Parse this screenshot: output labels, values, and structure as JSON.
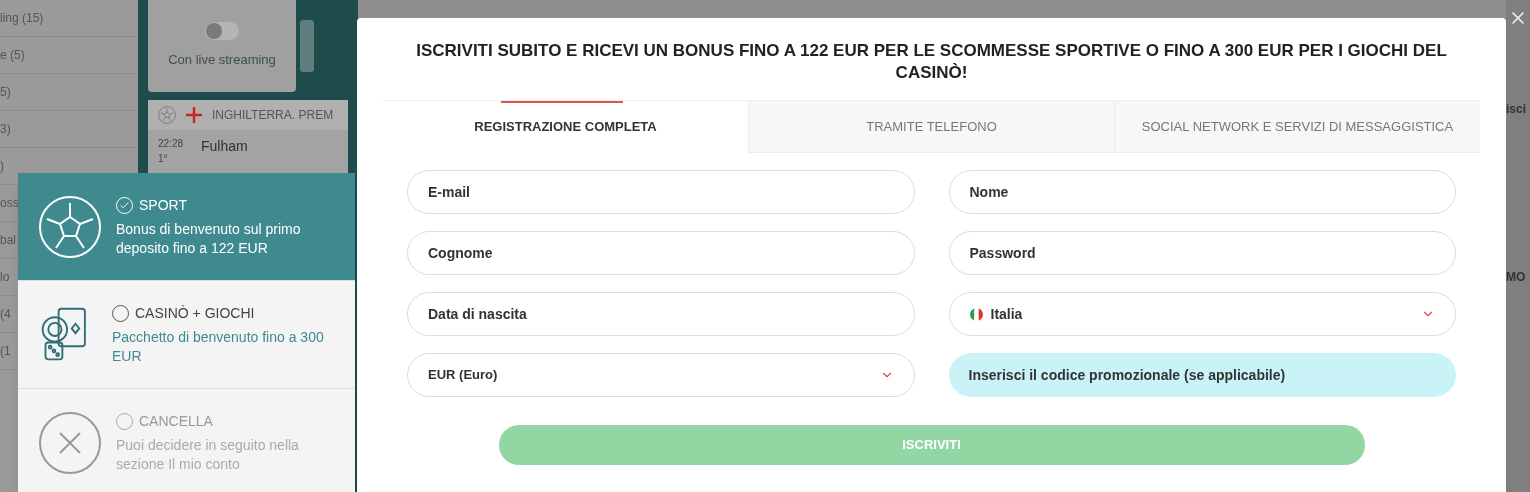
{
  "background": {
    "sidebar_items": [
      "ling (15)",
      "e (5)",
      "5)",
      "3)",
      ")",
      "oss",
      "bal",
      "lo",
      "(4",
      "(1"
    ],
    "streaming_toggle": {
      "label": "Con live streaming",
      "on": false
    },
    "league": {
      "name": "INGHILTERRA. PREM"
    },
    "match": {
      "time": "22:28",
      "period": "1°",
      "team": "Fulham"
    },
    "right_fragments": [
      "isci",
      "MO"
    ]
  },
  "bonus_options": [
    {
      "kind": "sport",
      "title": "SPORT",
      "description": "Bonus di benvenuto sul primo deposito fino a 122 EUR",
      "selected": true
    },
    {
      "kind": "casino",
      "title": "CASINÒ + GIOCHI",
      "description": "Pacchetto di benvenuto fino a 300 EUR",
      "selected": false
    },
    {
      "kind": "cancel",
      "title": "CANCELLA",
      "description": "Puoi decidere in seguito nella sezione Il mio conto",
      "selected": false
    }
  ],
  "modal": {
    "title": "ISCRIVITI SUBITO E RICEVI UN BONUS FINO A 122 EUR PER LE SCOMMESSE SPORTIVE O FINO A 300 EUR PER I GIOCHI DEL CASINÒ!",
    "tabs": [
      {
        "label": "REGISTRAZIONE COMPLETA",
        "selected": true
      },
      {
        "label": "TRAMITE TELEFONO",
        "selected": false
      },
      {
        "label": "SOCIAL NETWORK E SERVIZI DI MESSAGGISTICA",
        "selected": false
      }
    ],
    "fields": [
      {
        "kind": "text",
        "placeholder": "E-mail"
      },
      {
        "kind": "text",
        "placeholder": "Nome"
      },
      {
        "kind": "text",
        "placeholder": "Cognome"
      },
      {
        "kind": "text",
        "placeholder": "Password"
      },
      {
        "kind": "text",
        "placeholder": "Data di nascita"
      },
      {
        "kind": "country",
        "value": "Italia"
      },
      {
        "kind": "select",
        "value": "EUR (Euro)"
      },
      {
        "kind": "promo",
        "placeholder": "Inserisci il codice promozionale (se applicabile)"
      }
    ],
    "submit": "ISCRIVITI"
  }
}
